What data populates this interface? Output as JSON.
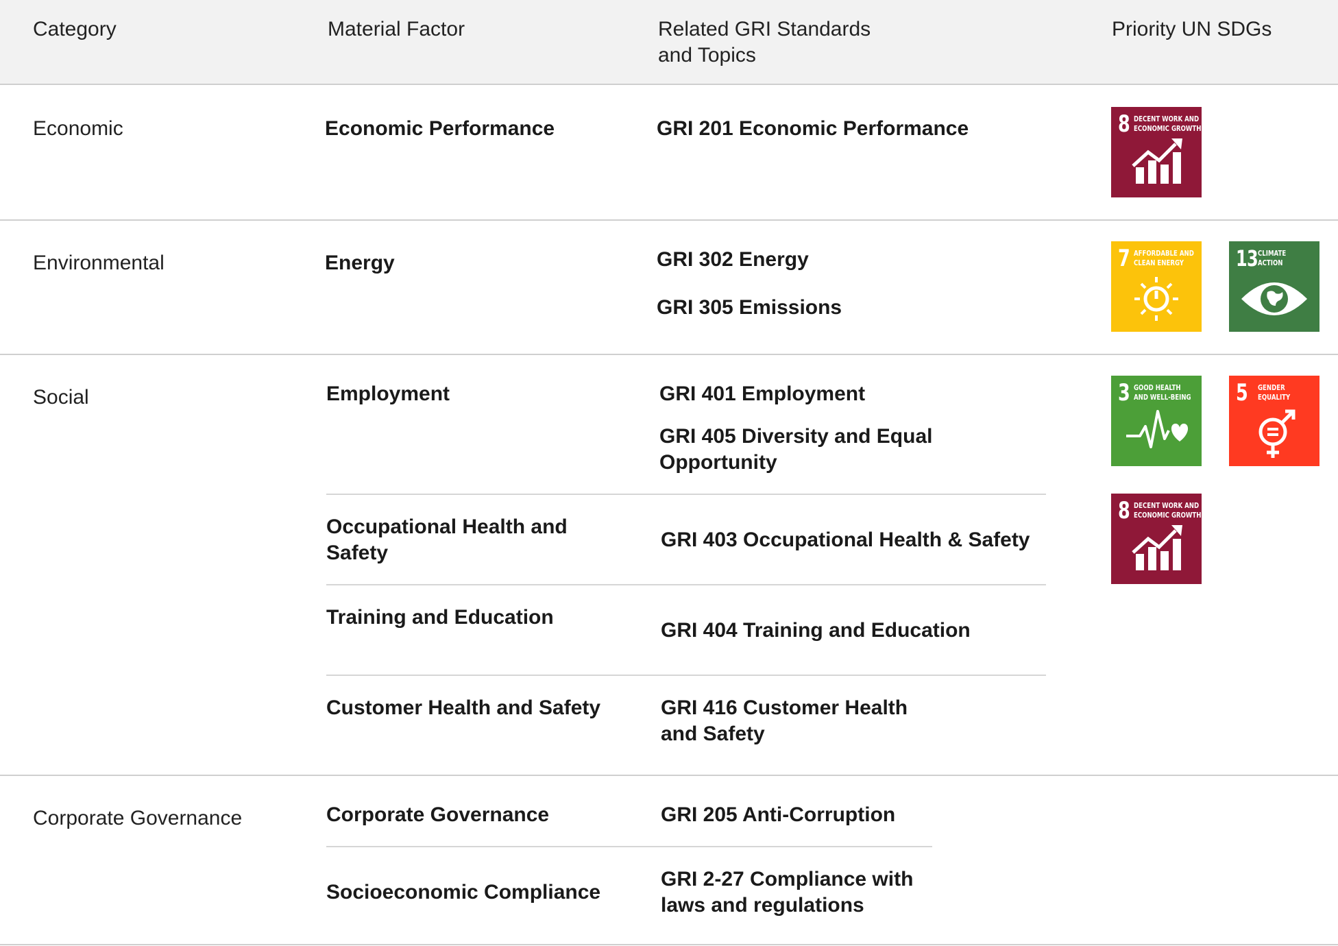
{
  "header": {
    "category": "Category",
    "material_factor": "Material Factor",
    "gri_line1": "Related GRI Standards",
    "gri_line2": "and Topics",
    "sdgs": "Priority UN SDGs"
  },
  "rows": {
    "economic": {
      "category": "Economic",
      "factor": "Economic Performance",
      "gri": [
        "GRI 201 Economic Performance"
      ]
    },
    "environmental": {
      "category": "Environmental",
      "factor": "Energy",
      "gri": [
        "GRI 302 Energy",
        "GRI 305 Emissions"
      ]
    },
    "social": {
      "category": "Social",
      "items": [
        {
          "factor": "Employment",
          "gri": [
            "GRI 401 Employment",
            "GRI 405 Diversity and Equal",
            "Opportunity"
          ]
        },
        {
          "factor_line1": "Occupational Health and",
          "factor_line2": "Safety",
          "gri": [
            "GRI 403 Occupational Health & Safety"
          ]
        },
        {
          "factor": "Training and Education",
          "gri": [
            "GRI 404 Training and Education"
          ]
        },
        {
          "factor": "Customer Health and Safety",
          "gri": [
            "GRI 416 Customer Health",
            "and Safety"
          ]
        }
      ]
    },
    "governance": {
      "category": "Corporate Governance",
      "items": [
        {
          "factor": "Corporate Governance",
          "gri": [
            "GRI 205 Anti-Corruption"
          ]
        },
        {
          "factor": "Socioeconomic Compliance",
          "gri": [
            "GRI 2-27 Compliance with",
            "laws and regulations"
          ]
        }
      ]
    }
  },
  "sdg_icons": {
    "sdg8": {
      "number": "8",
      "line1": "Decent work and",
      "line2": "economic growth",
      "color": "#8f1838",
      "icon": "bar-chart-arrow-icon"
    },
    "sdg7": {
      "number": "7",
      "line1": "Affordable and",
      "line2": "clean energy",
      "color": "#fcc30b",
      "icon": "sun-power-icon"
    },
    "sdg13": {
      "number": "13",
      "line1": "Climate",
      "line2": "action",
      "color": "#3f7e44",
      "icon": "eye-globe-icon"
    },
    "sdg3": {
      "number": "3",
      "line1": "Good health",
      "line2": "and well-being",
      "color": "#4c9f38",
      "icon": "heartbeat-icon"
    },
    "sdg5": {
      "number": "5",
      "line1": "Gender",
      "line2": "equality",
      "color": "#ff3a21",
      "icon": "gender-equality-icon"
    }
  }
}
